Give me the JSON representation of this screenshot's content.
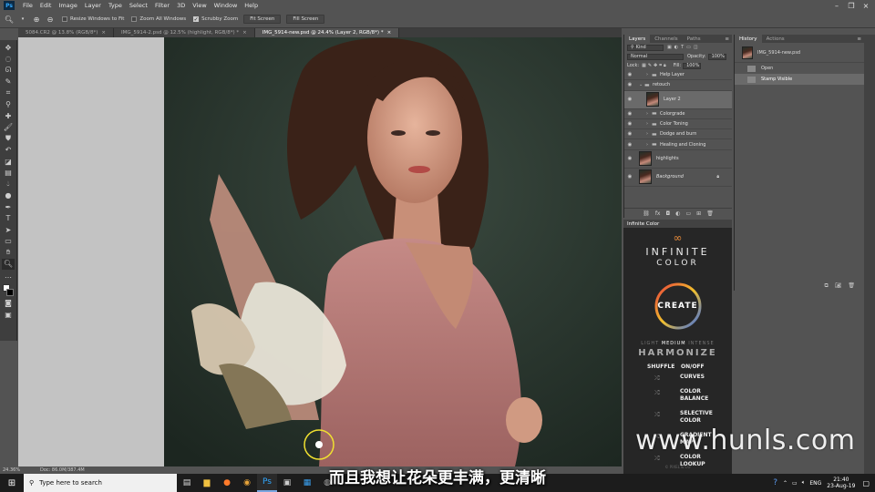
{
  "app": {
    "logo": "Ps",
    "menu": [
      "File",
      "Edit",
      "Image",
      "Layer",
      "Type",
      "Select",
      "Filter",
      "3D",
      "View",
      "Window",
      "Help"
    ]
  },
  "options_bar": {
    "resize_windows": "Resize Windows to Fit",
    "zoom_all_windows": "Zoom All Windows",
    "scrubby_zoom": "Scrubby Zoom",
    "fit_screen": "Fit Screen",
    "fill_screen": "Fill Screen"
  },
  "doc_tabs": [
    {
      "label": "5084.CR2 @ 13.8% (RGB/8*)",
      "active": false
    },
    {
      "label": "IMG_5914-2.psd @ 12.5% (highlight, RGB/8*) *",
      "active": false
    },
    {
      "label": "IMG_5914-new.psd @ 24.4% (Layer 2, RGB/8*) *",
      "active": true
    }
  ],
  "status": {
    "zoom": "24.36%",
    "doc": "Doc: 86.0M/387.4M"
  },
  "layers_panel": {
    "tabs": [
      "Layers",
      "Channels",
      "Paths"
    ],
    "filter": "Kind",
    "blend_mode": "Normal",
    "opacity_label": "Opacity:",
    "opacity_value": "100%",
    "lock_label": "Lock:",
    "fill_label": "Fill:",
    "fill_value": "100%",
    "layers": [
      {
        "name": "Help Layer",
        "type": "folder",
        "indent": 1
      },
      {
        "name": "retouch",
        "type": "folder-open",
        "indent": 0
      },
      {
        "name": "Layer 2",
        "type": "pixel",
        "indent": 1,
        "selected": true
      },
      {
        "name": "Colorgrade",
        "type": "folder",
        "indent": 1
      },
      {
        "name": "Color Toning",
        "type": "folder",
        "indent": 1
      },
      {
        "name": "Dodge and burn",
        "type": "folder",
        "indent": 1
      },
      {
        "name": "Healing and Cloning",
        "type": "folder",
        "indent": 1
      },
      {
        "name": "highlights",
        "type": "pixel",
        "indent": 0
      },
      {
        "name": "Background",
        "type": "background",
        "indent": 0
      }
    ]
  },
  "history_panel": {
    "tabs": [
      "History",
      "Actions"
    ],
    "snapshot": "IMG_5914-new.psd",
    "steps": [
      {
        "label": "Open",
        "active": false
      },
      {
        "label": "Stamp Visible",
        "active": true
      }
    ]
  },
  "infinite_color": {
    "header": "Infinite Color",
    "brand_top": "INFINITE",
    "brand_bottom": "COLOR",
    "create": "CREATE",
    "levels": [
      "LIGHT",
      "MEDIUM",
      "INTENSE"
    ],
    "harmonize": "HARMONIZE",
    "shuffle": "SHUFFLE",
    "onoff": "ON/OFF",
    "items": [
      "CURVES",
      "COLOR BALANCE",
      "SELECTIVE COLOR",
      "GRADIENT MAP",
      "COLOR LOOKUP"
    ],
    "footer": "© PIXEL & CO",
    "colors": {
      "ring_start": "#e8413b",
      "ring_mid": "#f2c02c",
      "ring_end": "#3b6ee8",
      "bg": "#262626"
    }
  },
  "taskbar": {
    "search_placeholder": "Type here to search",
    "lang": "ENG",
    "time": "21:40",
    "date": "23-Aug-19"
  },
  "subtitle": "而且我想让花朵更丰满，更清晰",
  "watermark": "www.hunls.com"
}
